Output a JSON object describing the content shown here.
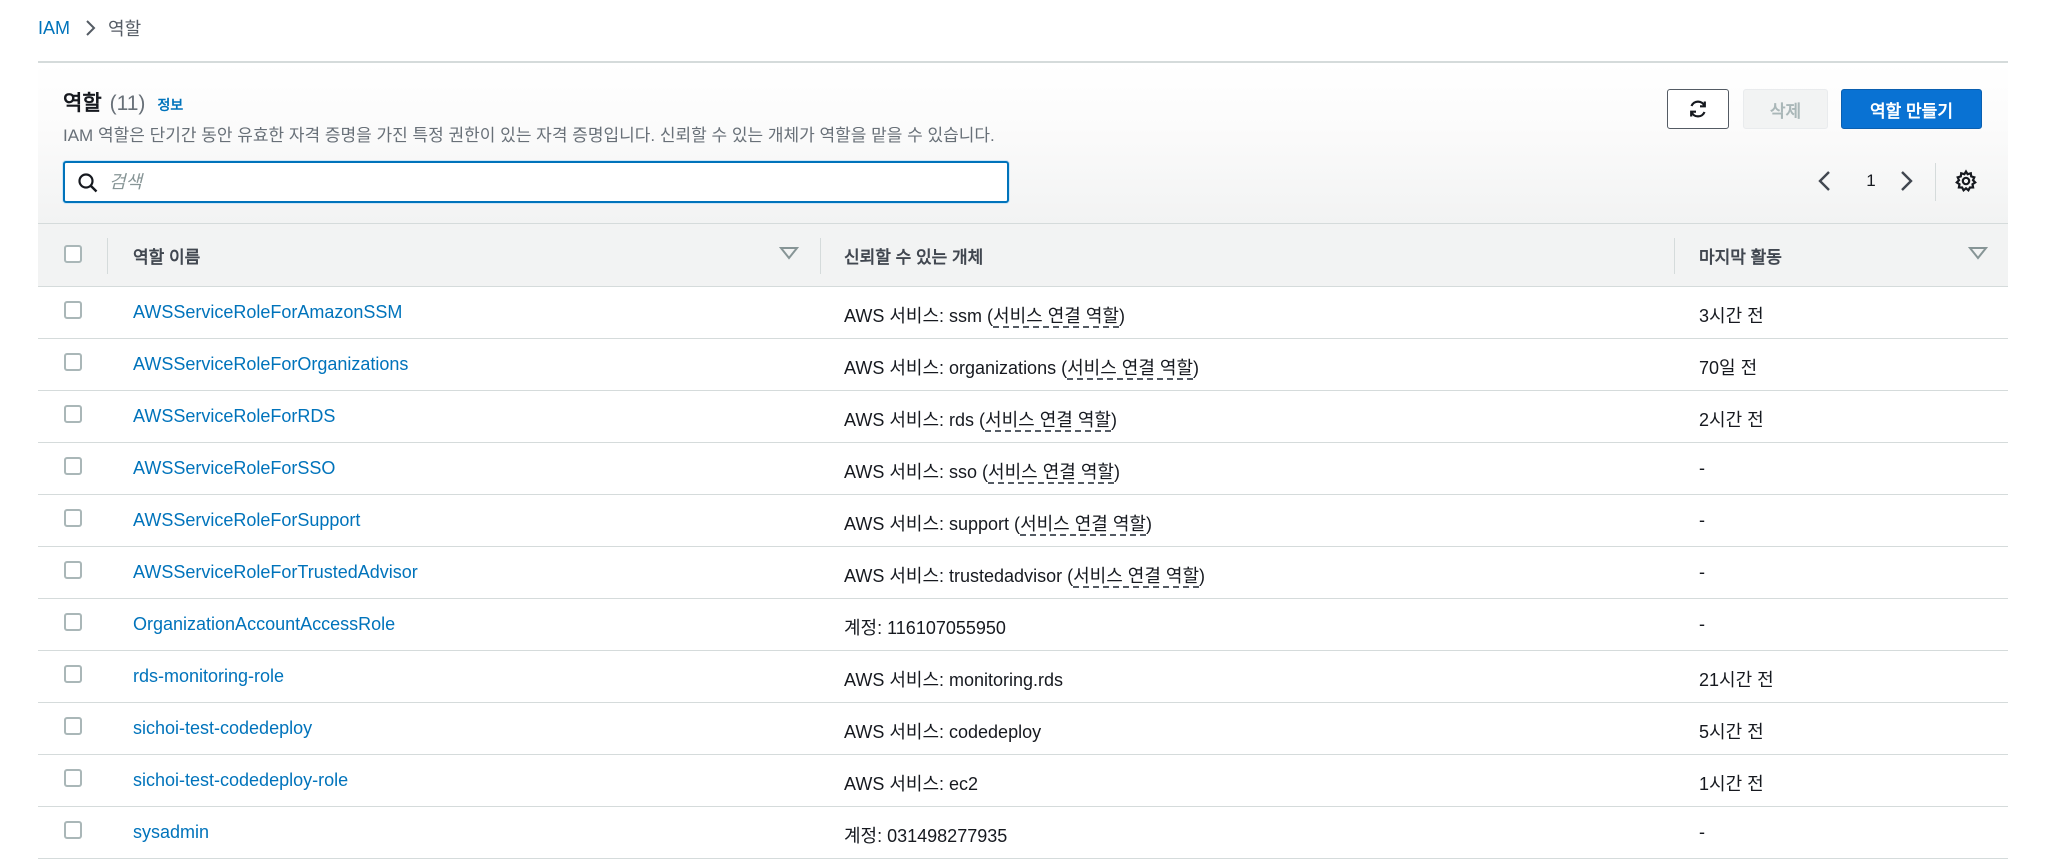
{
  "breadcrumb": {
    "root": "IAM",
    "current": "역할"
  },
  "header": {
    "title": "역할",
    "count": "(11)",
    "info": "정보",
    "description": "IAM 역할은 단기간 동안 유효한 자격 증명을 가진 특정 권한이 있는 자격 증명입니다. 신뢰할 수 있는 개체가 역할을 맡을 수 있습니다."
  },
  "actions": {
    "delete": "삭제",
    "create": "역할 만들기"
  },
  "search": {
    "placeholder": "검색",
    "value": ""
  },
  "pagination": {
    "page": "1"
  },
  "columns": {
    "name": "역할 이름",
    "trusted": "신뢰할 수 있는 개체",
    "last_activity": "마지막 활동"
  },
  "rows": [
    {
      "name": "AWSServiceRoleForAmazonSSM",
      "trusted_prefix": "AWS 서비스: ssm (",
      "trusted_link": "서비스 연결 역할",
      "trusted_suffix": ")",
      "last": "3시간 전"
    },
    {
      "name": "AWSServiceRoleForOrganizations",
      "trusted_prefix": "AWS 서비스: organizations (",
      "trusted_link": "서비스 연결 역할",
      "trusted_suffix": ")",
      "last": "70일 전"
    },
    {
      "name": "AWSServiceRoleForRDS",
      "trusted_prefix": "AWS 서비스: rds (",
      "trusted_link": "서비스 연결 역할",
      "trusted_suffix": ")",
      "last": "2시간 전"
    },
    {
      "name": "AWSServiceRoleForSSO",
      "trusted_prefix": "AWS 서비스: sso (",
      "trusted_link": "서비스 연결 역할",
      "trusted_suffix": ")",
      "last": "-"
    },
    {
      "name": "AWSServiceRoleForSupport",
      "trusted_prefix": "AWS 서비스: support (",
      "trusted_link": "서비스 연결 역할",
      "trusted_suffix": ")",
      "last": "-"
    },
    {
      "name": "AWSServiceRoleForTrustedAdvisor",
      "trusted_prefix": "AWS 서비스: trustedadvisor (",
      "trusted_link": "서비스 연결 역할",
      "trusted_suffix": ")",
      "last": "-"
    },
    {
      "name": "OrganizationAccountAccessRole",
      "trusted_prefix": "계정: 116107055950",
      "trusted_link": "",
      "trusted_suffix": "",
      "last": "-"
    },
    {
      "name": "rds-monitoring-role",
      "trusted_prefix": "AWS 서비스: monitoring.rds",
      "trusted_link": "",
      "trusted_suffix": "",
      "last": "21시간 전"
    },
    {
      "name": "sichoi-test-codedeploy",
      "trusted_prefix": "AWS 서비스: codedeploy",
      "trusted_link": "",
      "trusted_suffix": "",
      "last": "5시간 전"
    },
    {
      "name": "sichoi-test-codedeploy-role",
      "trusted_prefix": "AWS 서비스: ec2",
      "trusted_link": "",
      "trusted_suffix": "",
      "last": "1시간 전"
    },
    {
      "name": "sysadmin",
      "trusted_prefix": "계정: 031498277935",
      "trusted_link": "",
      "trusted_suffix": "",
      "last": "-"
    }
  ]
}
